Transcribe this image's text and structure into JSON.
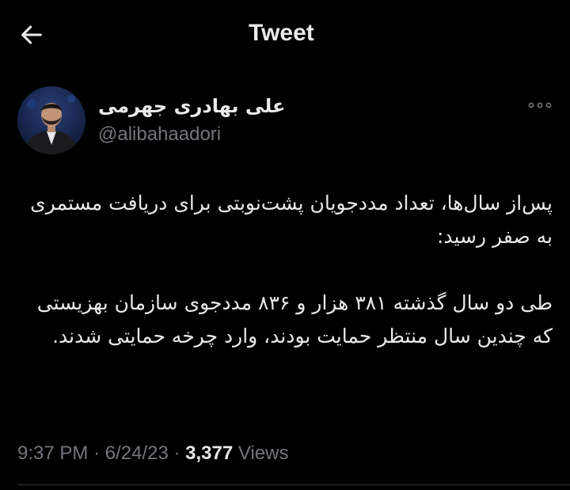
{
  "header": {
    "title": "Tweet",
    "back_icon": "arrow-left-icon"
  },
  "author": {
    "display_name": "علی بهادری جهرمی",
    "handle": "@alibahaadori",
    "more_icon": "more-options-icon"
  },
  "tweet": {
    "paragraph_1": "پس‌از سال‌ها، تعداد مددجویان پشت‌نوبتی برای دریافت مستمری به صفر رسید:",
    "paragraph_2": "طی دو سال گذشته ۳۸۱ هزار و ۸۳۶ مددجوی سازمان بهزیستی که چندین سال منتظر حمایت بودند، وارد چرخه حمایتی شدند."
  },
  "meta": {
    "time": "9:37 PM",
    "separator": "·",
    "date": "6/24/23",
    "views_count": "3,377",
    "views_label": "Views"
  },
  "colors": {
    "background": "#000000",
    "text_primary": "#e7e9ea",
    "text_secondary": "#71767b",
    "divider": "#2f3336"
  }
}
